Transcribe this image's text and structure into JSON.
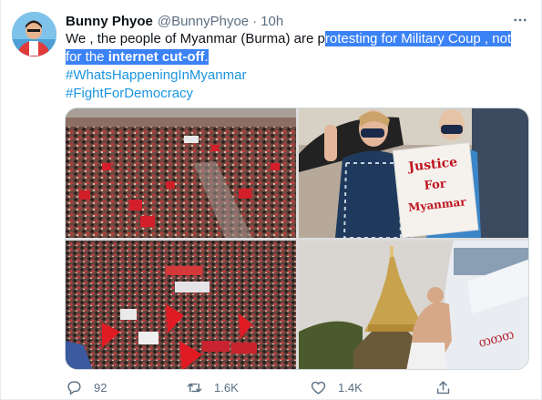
{
  "tweet": {
    "display_name": "Bunny Phyoe",
    "handle": "@BunnyPhyoe",
    "separator": "·",
    "time": "10h",
    "text_line1_plain": "We , the people of Myanmar (Burma) are p",
    "text_line1_selected": "rotesting for Military Coup , not",
    "text_line2_selected_start": "for the ",
    "text_line2_selected_bold": "internet cut-off",
    "text_line2_selected_end": ".",
    "hashtags": [
      "#WhatsHappeningInMyanmar",
      "#FightForDemocracy"
    ],
    "photo_sign_text": [
      "Justice",
      "For",
      "Myanmar"
    ]
  },
  "actions": {
    "reply_count": "92",
    "retweet_count": "1.6K",
    "like_count": "1.4K"
  },
  "colors": {
    "text": "#0f1419",
    "muted": "#5b7083",
    "link": "#1b95e0",
    "selection": "#3b82f6"
  },
  "icons": [
    "more-icon",
    "reply-icon",
    "retweet-icon",
    "like-icon",
    "share-icon"
  ]
}
